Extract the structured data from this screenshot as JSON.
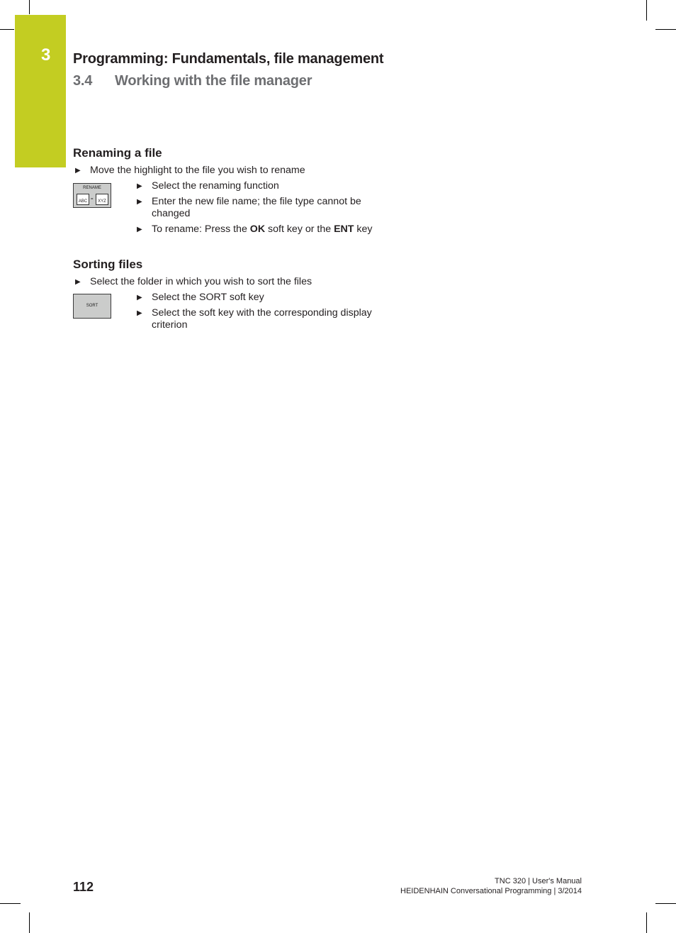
{
  "chapter": {
    "number": "3",
    "title": "Programming: Fundamentals, file management",
    "section_number": "3.4",
    "section_title": "Working with the file manager"
  },
  "colors": {
    "tab_accent": "#c3cd22",
    "section_gray": "#6d6e71"
  },
  "renaming": {
    "heading": "Renaming a file",
    "step1": "Move the highlight to the file you wish to rename",
    "softkey": {
      "label": "RENAME",
      "from": "ABC",
      "sep": "=",
      "to": "XYZ",
      "icon": "rename-softkey-icon"
    },
    "step2": "Select the renaming function",
    "step3": "Enter the new file name; the file type cannot be changed",
    "step4_pre": "To rename: Press the ",
    "step4_ok": "OK",
    "step4_mid": " soft key or the ",
    "step4_ent": "ENT",
    "step4_post": " key"
  },
  "sorting": {
    "heading": "Sorting files",
    "step1": "Select the folder in which you wish to sort the files",
    "softkey": {
      "label": "SORT"
    },
    "step2": "Select the SORT soft key",
    "step3": "Select the soft key with the corresponding display criterion"
  },
  "footer": {
    "page_number": "112",
    "line1": "TNC 320 | User's Manual",
    "line2": "HEIDENHAIN Conversational Programming | 3/2014"
  },
  "glyphs": {
    "arrow": "▶"
  }
}
